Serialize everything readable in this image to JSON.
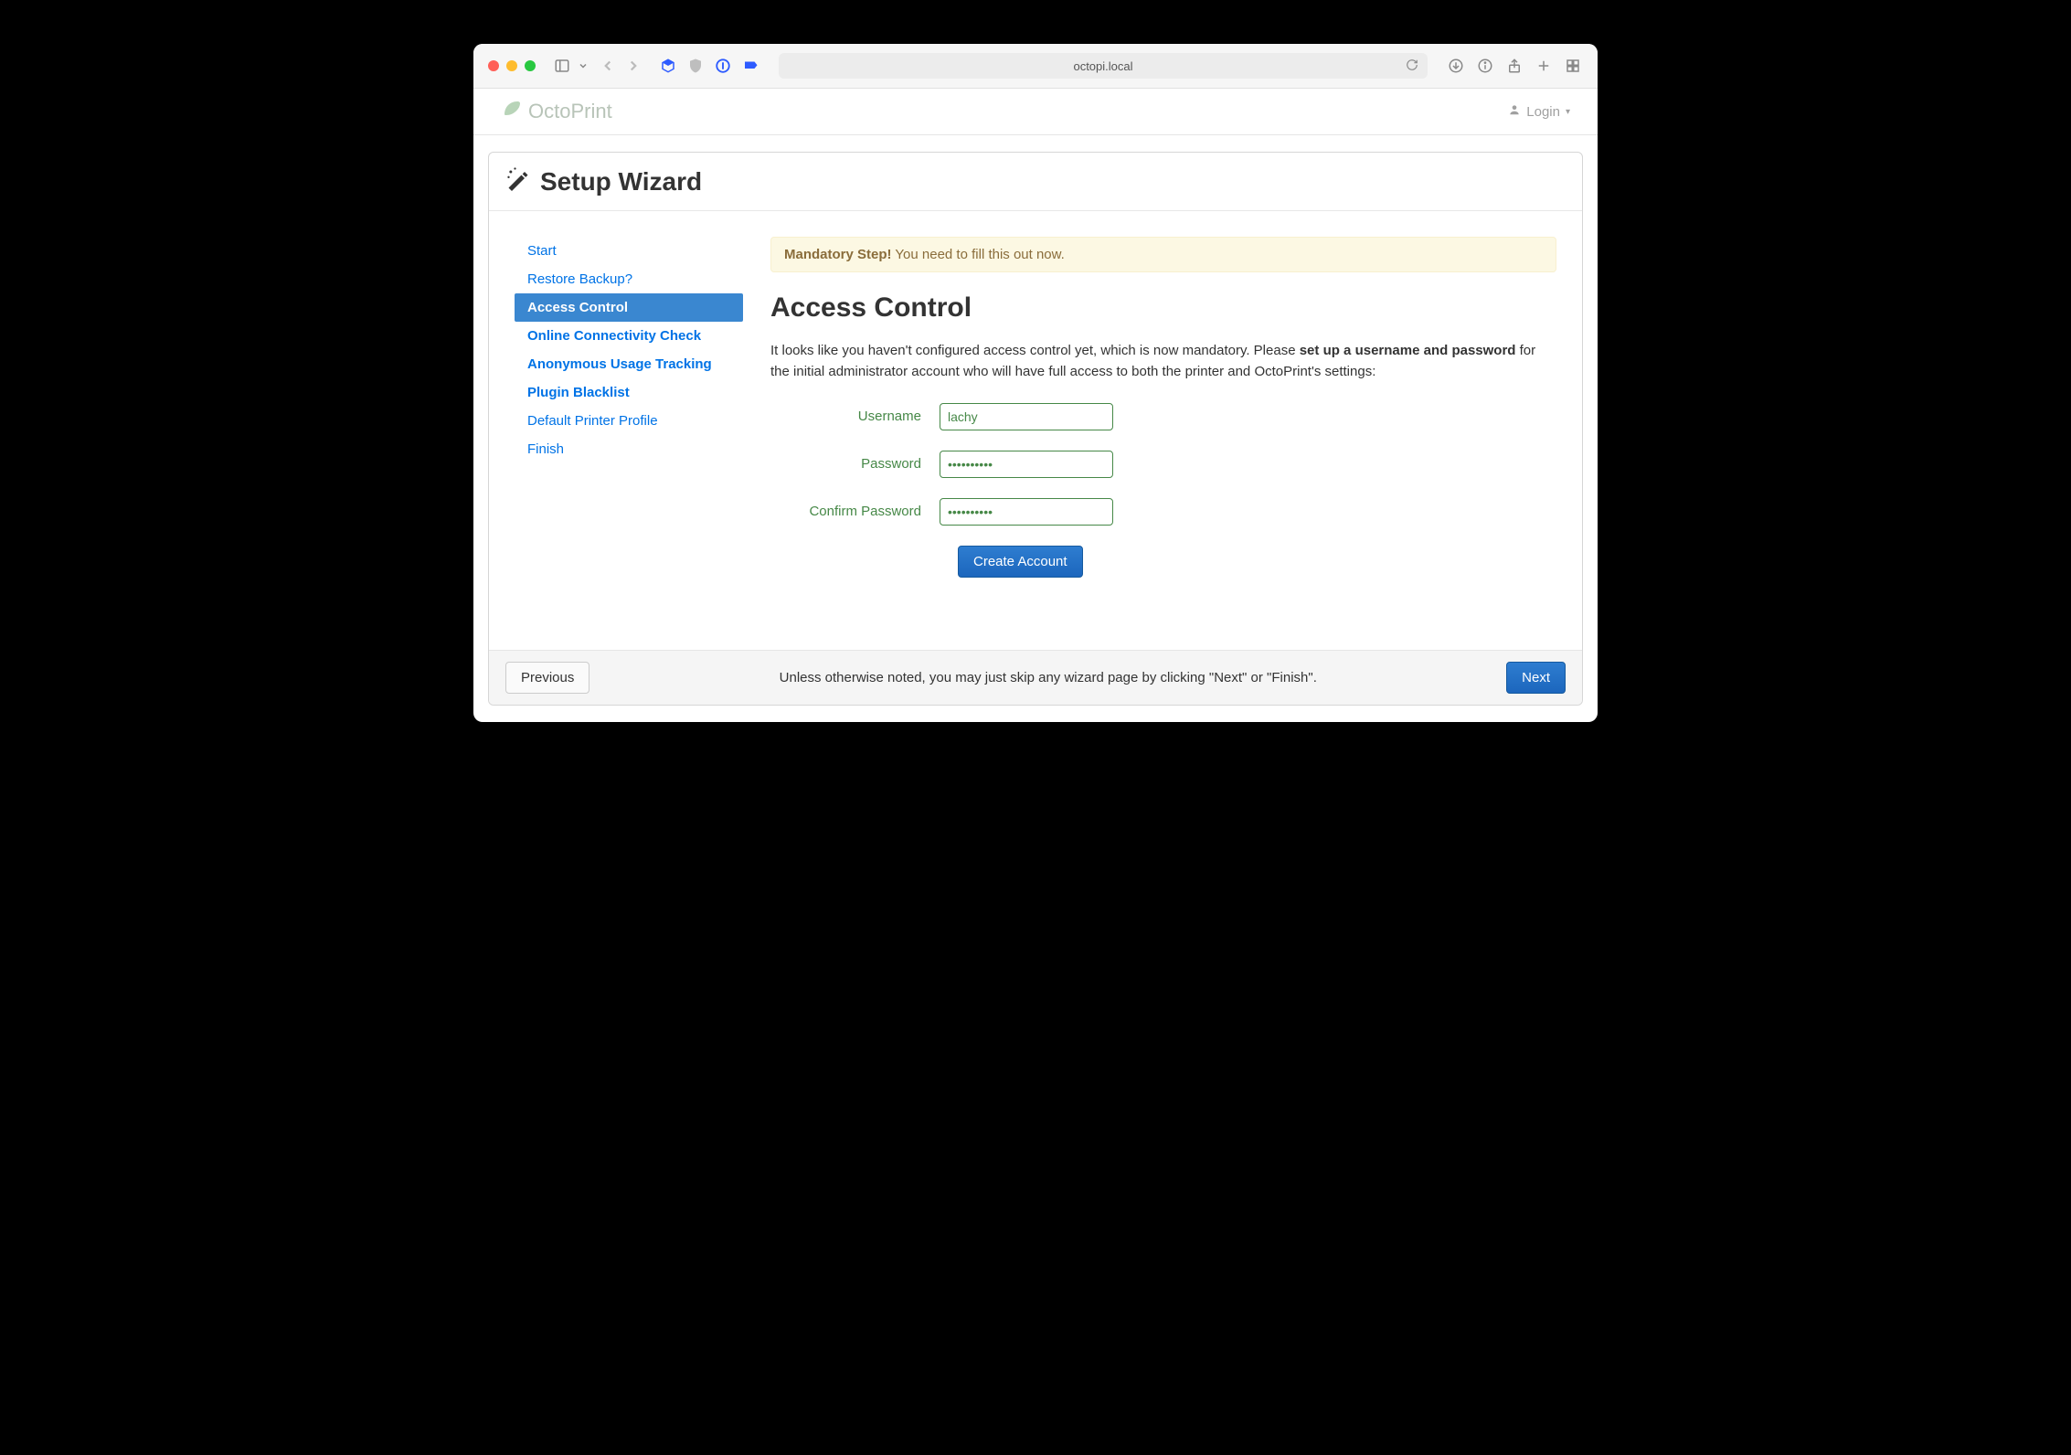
{
  "browser": {
    "url": "octopi.local"
  },
  "app": {
    "brand": "OctoPrint",
    "login_label": "Login"
  },
  "wizard": {
    "title": "Setup Wizard",
    "steps": [
      {
        "label": "Start",
        "bold": false
      },
      {
        "label": "Restore Backup?",
        "bold": false
      },
      {
        "label": "Access Control",
        "bold": true,
        "active": true
      },
      {
        "label": "Online Connectivity Check",
        "bold": true
      },
      {
        "label": "Anonymous Usage Tracking",
        "bold": true
      },
      {
        "label": "Plugin Blacklist",
        "bold": true
      },
      {
        "label": "Default Printer Profile",
        "bold": false
      },
      {
        "label": "Finish",
        "bold": false
      }
    ],
    "alert_strong": "Mandatory Step!",
    "alert_text": " You need to fill this out now.",
    "heading": "Access Control",
    "para_1": "It looks like you haven't configured access control yet, which is now mandatory. Please ",
    "para_bold": "set up a username and password",
    "para_2": " for the initial administrator account who will have full access to both the printer and OctoPrint's settings:",
    "form": {
      "username_label": "Username",
      "username_value": "lachy",
      "password_label": "Password",
      "password_value": "••••••••••",
      "confirm_label": "Confirm Password",
      "confirm_value": "••••••••••",
      "create_label": "Create Account"
    },
    "footer": {
      "prev": "Previous",
      "hint": "Unless otherwise noted, you may just skip any wizard page by clicking \"Next\" or \"Finish\".",
      "next": "Next"
    }
  }
}
